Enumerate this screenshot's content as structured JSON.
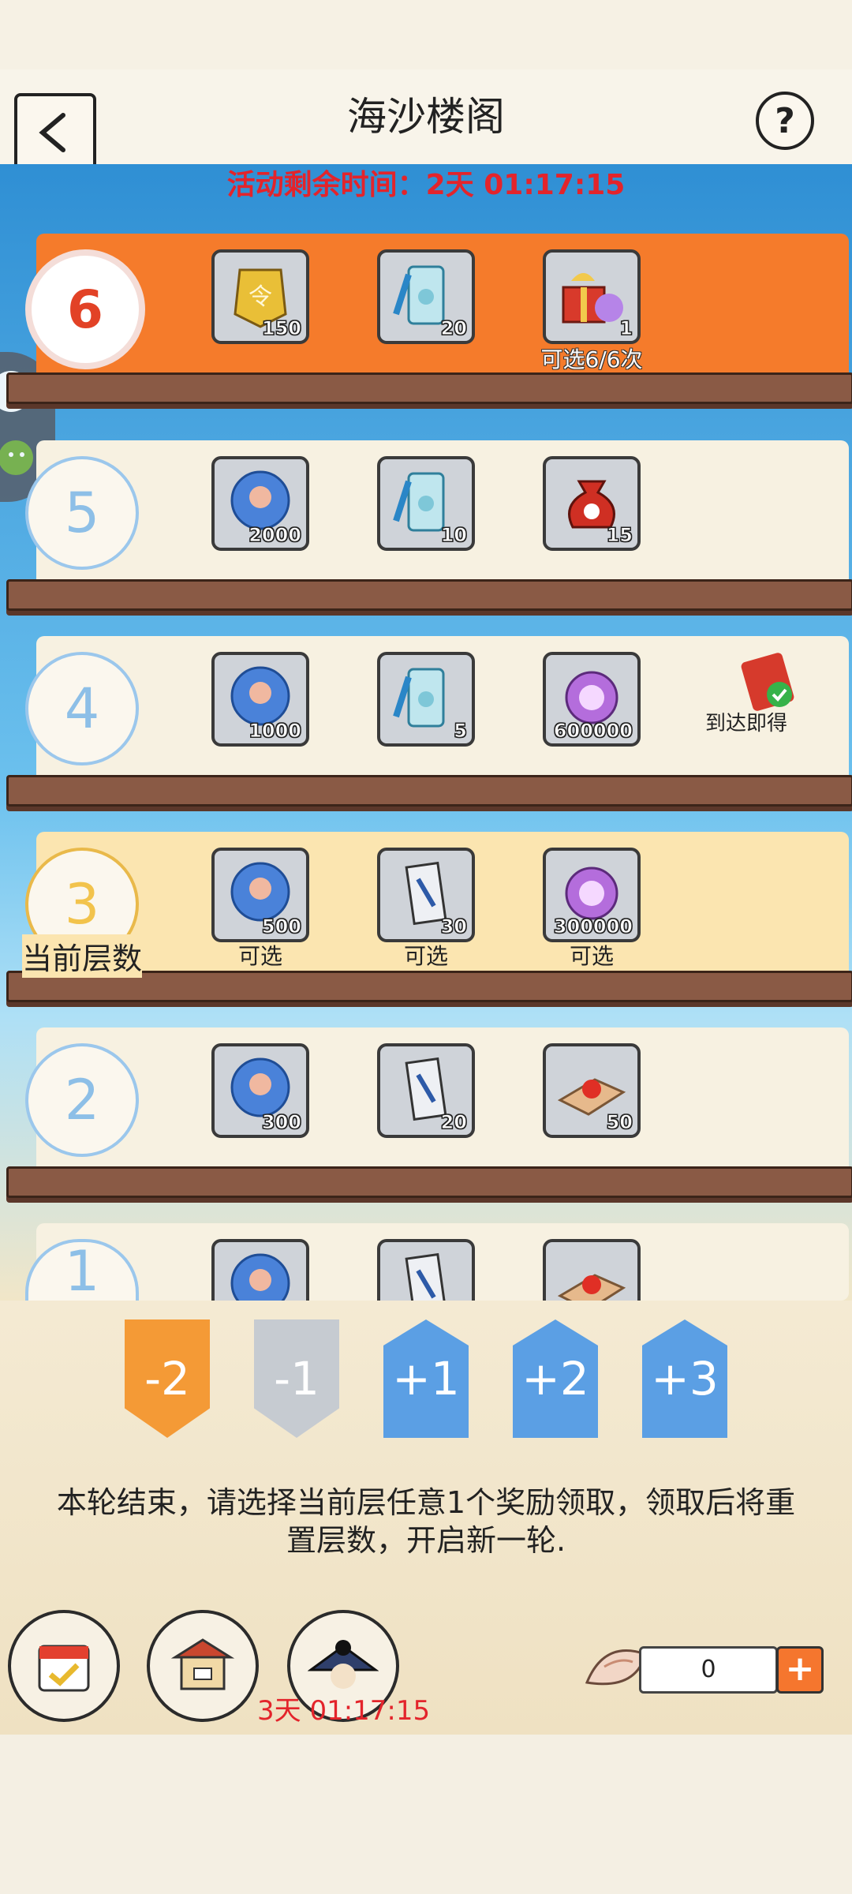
{
  "header": {
    "title": "海沙楼阁",
    "help_label": "?"
  },
  "event_timer": "活动剩余时间：2天 01:17:15",
  "current_floor_label": "当前层数",
  "floors": [
    {
      "number": "6",
      "items": [
        {
          "icon": "gold-badge-icon",
          "qty": "150"
        },
        {
          "icon": "blue-talisman-icon",
          "qty": "20"
        },
        {
          "icon": "gift-box-icon",
          "qty": "1"
        }
      ],
      "extra": "可选6/6次"
    },
    {
      "number": "5",
      "items": [
        {
          "icon": "blue-orb-icon",
          "qty": "2000"
        },
        {
          "icon": "blue-talisman-icon",
          "qty": "10"
        },
        {
          "icon": "red-money-bag-icon",
          "qty": "15"
        }
      ]
    },
    {
      "number": "4",
      "items": [
        {
          "icon": "blue-orb-icon",
          "qty": "1000"
        },
        {
          "icon": "blue-talisman-icon",
          "qty": "5"
        },
        {
          "icon": "purple-coin-icon",
          "qty": "600000"
        }
      ],
      "reward_label": "到达即得"
    },
    {
      "number": "3",
      "items": [
        {
          "icon": "blue-orb-icon",
          "qty": "500",
          "caption": "可选"
        },
        {
          "icon": "scroll-icon",
          "qty": "30",
          "caption": "可选"
        },
        {
          "icon": "purple-coin-icon",
          "qty": "300000",
          "caption": "可选"
        }
      ]
    },
    {
      "number": "2",
      "items": [
        {
          "icon": "blue-orb-icon",
          "qty": "300"
        },
        {
          "icon": "scroll-icon",
          "qty": "20"
        },
        {
          "icon": "red-bead-cloth-icon",
          "qty": "50"
        }
      ]
    },
    {
      "number": "1"
    }
  ],
  "steps": [
    "-2",
    "-1",
    "+1",
    "+2",
    "+3"
  ],
  "notice": "本轮结束，请选择当前层任意1个奖励领取，领取后将重置层数，开启新一轮.",
  "bottom": {
    "timer": "3天 01:17:15",
    "shell_count": "0",
    "plus_label": "+"
  },
  "colors": {
    "accent_orange": "#f57b2b",
    "timer_red": "#e3242b",
    "step_blue": "#5b9fe4"
  }
}
